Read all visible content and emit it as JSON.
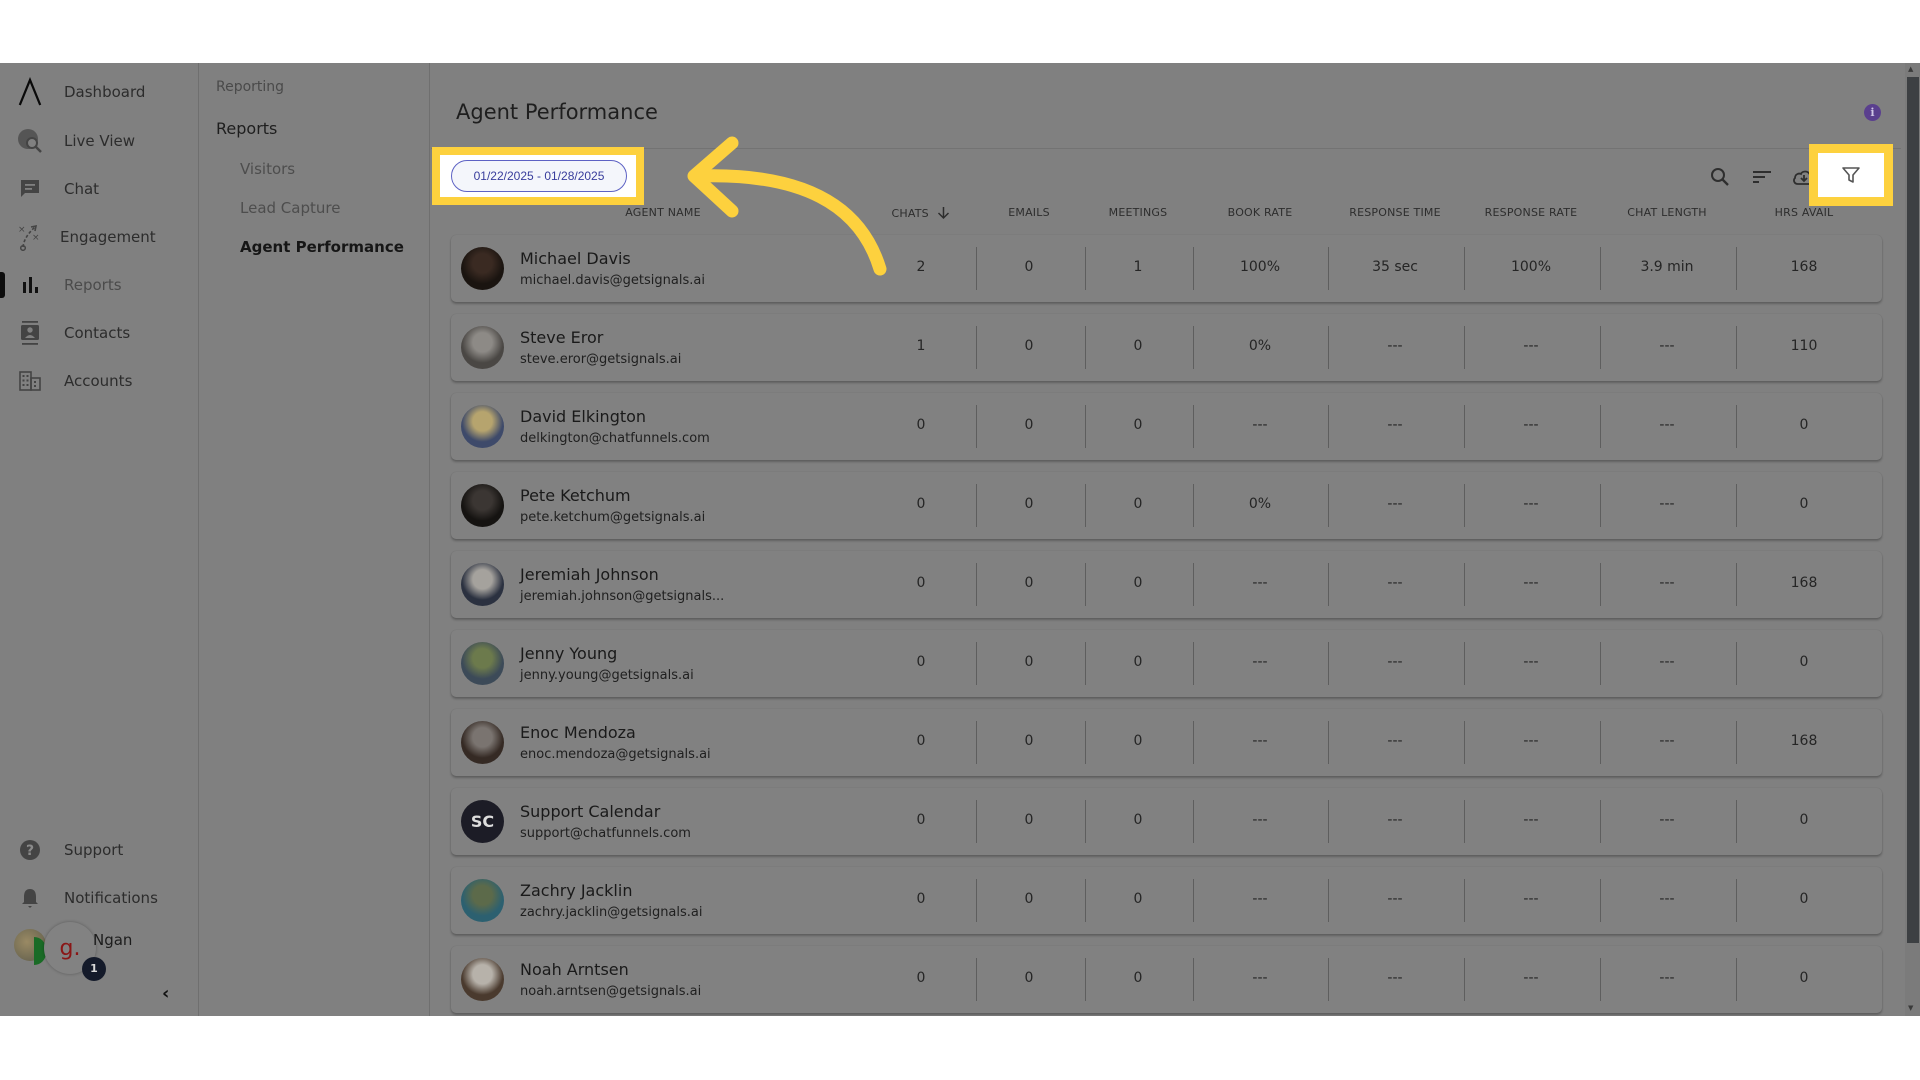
{
  "sidebar": {
    "items": [
      {
        "label": "Dashboard",
        "icon": "logo-icon"
      },
      {
        "label": "Live View",
        "icon": "live-view-icon"
      },
      {
        "label": "Chat",
        "icon": "chat-icon"
      },
      {
        "label": "Engagement",
        "icon": "engagement-icon"
      },
      {
        "label": "Reports",
        "icon": "bar-chart-icon",
        "active": true
      },
      {
        "label": "Contacts",
        "icon": "contacts-icon"
      },
      {
        "label": "Accounts",
        "icon": "building-icon"
      }
    ],
    "bottom": [
      {
        "label": "Support",
        "icon": "help-icon"
      },
      {
        "label": "Notifications",
        "icon": "bell-icon"
      }
    ],
    "user": {
      "name": "Ngan",
      "org_initial": "g.",
      "badge_count": "1"
    },
    "collapse_icon": "‹"
  },
  "subnav": {
    "breadcrumb": "Reporting",
    "section": "Reports",
    "items": [
      "Visitors",
      "Lead Capture",
      "Agent Performance"
    ],
    "active": "Agent Performance"
  },
  "main": {
    "title": "Agent Performance",
    "info_icon": "i",
    "date_range": "01/22/2025 - 01/28/2025",
    "toolbar": [
      "search-icon",
      "sort-icon",
      "cloud-download-icon",
      "filter-icon"
    ],
    "columns": [
      "AGENT NAME",
      "CHATS",
      "EMAILS",
      "MEETINGS",
      "BOOK RATE",
      "RESPONSE TIME",
      "RESPONSE RATE",
      "CHAT LENGTH",
      "HRS AVAIL"
    ],
    "sort_column": "CHATS",
    "sort_direction": "desc",
    "rows": [
      {
        "name": "Michael Davis",
        "email": "michael.davis@getsignals.ai",
        "avatar": "photo",
        "values": [
          "2",
          "0",
          "1",
          "100%",
          "35 sec",
          "100%",
          "3.9 min",
          "168"
        ]
      },
      {
        "name": "Steve Eror",
        "email": "steve.eror@getsignals.ai",
        "avatar": "photo",
        "values": [
          "1",
          "0",
          "0",
          "0%",
          "---",
          "---",
          "---",
          "110"
        ]
      },
      {
        "name": "David Elkington",
        "email": "delkington@chatfunnels.com",
        "avatar": "photo",
        "values": [
          "0",
          "0",
          "0",
          "---",
          "---",
          "---",
          "---",
          "0"
        ]
      },
      {
        "name": "Pete Ketchum",
        "email": "pete.ketchum@getsignals.ai",
        "avatar": "photo",
        "values": [
          "0",
          "0",
          "0",
          "0%",
          "---",
          "---",
          "---",
          "0"
        ]
      },
      {
        "name": "Jeremiah Johnson",
        "email": "jeremiah.johnson@getsignals...",
        "avatar": "photo",
        "values": [
          "0",
          "0",
          "0",
          "---",
          "---",
          "---",
          "---",
          "168"
        ]
      },
      {
        "name": "Jenny Young",
        "email": "jenny.young@getsignals.ai",
        "avatar": "photo",
        "values": [
          "0",
          "0",
          "0",
          "---",
          "---",
          "---",
          "---",
          "0"
        ]
      },
      {
        "name": "Enoc Mendoza",
        "email": "enoc.mendoza@getsignals.ai",
        "avatar": "photo",
        "values": [
          "0",
          "0",
          "0",
          "---",
          "---",
          "---",
          "---",
          "168"
        ]
      },
      {
        "name": "Support Calendar",
        "email": "support@chatfunnels.com",
        "avatar": "initials",
        "initials": "SC",
        "values": [
          "0",
          "0",
          "0",
          "---",
          "---",
          "---",
          "---",
          "0"
        ]
      },
      {
        "name": "Zachry Jacklin",
        "email": "zachry.jacklin@getsignals.ai",
        "avatar": "photo",
        "values": [
          "0",
          "0",
          "0",
          "---",
          "---",
          "---",
          "---",
          "0"
        ]
      },
      {
        "name": "Noah Arntsen",
        "email": "noah.arntsen@getsignals.ai",
        "avatar": "photo",
        "values": [
          "0",
          "0",
          "0",
          "---",
          "---",
          "---",
          "---",
          "0"
        ]
      }
    ]
  },
  "annotation": {
    "highlight_color": "#fdd13e",
    "highlighted": [
      "date-range-pill",
      "filter-button"
    ]
  },
  "colors": {
    "accent": "#383d9c",
    "info": "#5a3f8e",
    "overlay": "#808080"
  }
}
